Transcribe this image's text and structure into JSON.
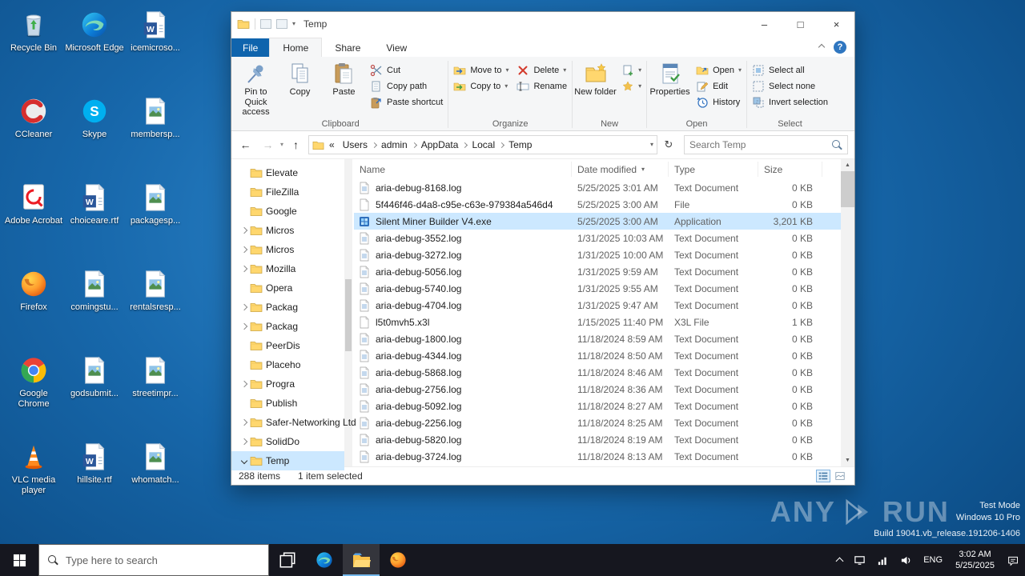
{
  "desktop": {
    "icons": [
      {
        "label": "Recycle Bin",
        "icon": "recycle-bin"
      },
      {
        "label": "CCleaner",
        "icon": "ccleaner"
      },
      {
        "label": "Adobe Acrobat",
        "icon": "acrobat"
      },
      {
        "label": "Firefox",
        "icon": "firefox"
      },
      {
        "label": "Google Chrome",
        "icon": "chrome"
      },
      {
        "label": "VLC media player",
        "icon": "vlc"
      },
      {
        "label": "Microsoft Edge",
        "icon": "edge"
      },
      {
        "label": "Skype",
        "icon": "skype"
      },
      {
        "label": "choiceare.rtf",
        "icon": "word-doc"
      },
      {
        "label": "comingstu...",
        "icon": "image-doc"
      },
      {
        "label": "godsubmit...",
        "icon": "image-doc"
      },
      {
        "label": "hillsite.rtf",
        "icon": "word-doc"
      },
      {
        "label": "icemicroso...",
        "icon": "word-doc"
      },
      {
        "label": "membersp...",
        "icon": "image-doc"
      },
      {
        "label": "packagesp...",
        "icon": "image-doc"
      },
      {
        "label": "rentalsresp...",
        "icon": "image-doc"
      },
      {
        "label": "streetimpr...",
        "icon": "image-doc"
      },
      {
        "label": "whomatch...",
        "icon": "image-doc"
      }
    ]
  },
  "window": {
    "title": "Temp",
    "tabs": [
      "File",
      "Home",
      "Share",
      "View"
    ],
    "ribbon": {
      "clipboard": {
        "label": "Clipboard",
        "pin": "Pin to Quick access",
        "copy": "Copy",
        "paste": "Paste",
        "cut": "Cut",
        "copy_path": "Copy path",
        "paste_shortcut": "Paste shortcut"
      },
      "organize": {
        "label": "Organize",
        "move_to": "Move to",
        "copy_to": "Copy to",
        "delete": "Delete",
        "rename": "Rename"
      },
      "new_group": {
        "label": "New",
        "new_folder": "New folder"
      },
      "open_group": {
        "label": "Open",
        "properties": "Properties",
        "open": "Open",
        "edit": "Edit",
        "history": "History"
      },
      "select_group": {
        "label": "Select",
        "select_all": "Select all",
        "select_none": "Select none",
        "invert": "Invert selection"
      }
    },
    "address": {
      "overflow": "«",
      "crumbs": [
        "Users",
        "admin",
        "AppData",
        "Local",
        "Temp"
      ]
    },
    "search_placeholder": "Search Temp",
    "nav": {
      "items": [
        {
          "label": "Elevate",
          "state": "none"
        },
        {
          "label": "FileZilla",
          "state": "none"
        },
        {
          "label": "Google",
          "state": "none"
        },
        {
          "label": "Micros",
          "state": "collapsed"
        },
        {
          "label": "Micros",
          "state": "collapsed"
        },
        {
          "label": "Mozilla",
          "state": "collapsed"
        },
        {
          "label": "Opera",
          "state": "none"
        },
        {
          "label": "Packag",
          "state": "collapsed"
        },
        {
          "label": "Packag",
          "state": "collapsed"
        },
        {
          "label": "PeerDis",
          "state": "none"
        },
        {
          "label": "Placeho",
          "state": "none"
        },
        {
          "label": "Progra",
          "state": "collapsed"
        },
        {
          "label": "Publish",
          "state": "none"
        },
        {
          "label": "Safer-Networking Ltd",
          "state": "collapsed"
        },
        {
          "label": "SolidDo",
          "state": "collapsed"
        },
        {
          "label": "Temp",
          "state": "expanded",
          "selected": true
        }
      ]
    },
    "list": {
      "columns": [
        "Name",
        "Date modified",
        "Type",
        "Size"
      ],
      "files": [
        {
          "name": "aria-debug-8168.log",
          "modified": "5/25/2025 3:01 AM",
          "type": "Text Document",
          "size": "0 KB",
          "icon": "text-doc"
        },
        {
          "name": "5f446f46-d4a8-c95e-c63e-979384a546d4",
          "modified": "5/25/2025 3:00 AM",
          "type": "File",
          "size": "0 KB",
          "icon": "file"
        },
        {
          "name": "Silent Miner Builder V4.exe",
          "modified": "5/25/2025 3:00 AM",
          "type": "Application",
          "size": "3,201 KB",
          "icon": "app",
          "selected": true
        },
        {
          "name": "aria-debug-3552.log",
          "modified": "1/31/2025 10:03 AM",
          "type": "Text Document",
          "size": "0 KB",
          "icon": "text-doc"
        },
        {
          "name": "aria-debug-3272.log",
          "modified": "1/31/2025 10:00 AM",
          "type": "Text Document",
          "size": "0 KB",
          "icon": "text-doc"
        },
        {
          "name": "aria-debug-5056.log",
          "modified": "1/31/2025 9:59 AM",
          "type": "Text Document",
          "size": "0 KB",
          "icon": "text-doc"
        },
        {
          "name": "aria-debug-5740.log",
          "modified": "1/31/2025 9:55 AM",
          "type": "Text Document",
          "size": "0 KB",
          "icon": "text-doc"
        },
        {
          "name": "aria-debug-4704.log",
          "modified": "1/31/2025 9:47 AM",
          "type": "Text Document",
          "size": "0 KB",
          "icon": "text-doc"
        },
        {
          "name": "l5t0mvh5.x3l",
          "modified": "1/15/2025 11:40 PM",
          "type": "X3L File",
          "size": "1 KB",
          "icon": "file"
        },
        {
          "name": "aria-debug-1800.log",
          "modified": "11/18/2024 8:59 AM",
          "type": "Text Document",
          "size": "0 KB",
          "icon": "text-doc"
        },
        {
          "name": "aria-debug-4344.log",
          "modified": "11/18/2024 8:50 AM",
          "type": "Text Document",
          "size": "0 KB",
          "icon": "text-doc"
        },
        {
          "name": "aria-debug-5868.log",
          "modified": "11/18/2024 8:46 AM",
          "type": "Text Document",
          "size": "0 KB",
          "icon": "text-doc"
        },
        {
          "name": "aria-debug-2756.log",
          "modified": "11/18/2024 8:36 AM",
          "type": "Text Document",
          "size": "0 KB",
          "icon": "text-doc"
        },
        {
          "name": "aria-debug-5092.log",
          "modified": "11/18/2024 8:27 AM",
          "type": "Text Document",
          "size": "0 KB",
          "icon": "text-doc"
        },
        {
          "name": "aria-debug-2256.log",
          "modified": "11/18/2024 8:25 AM",
          "type": "Text Document",
          "size": "0 KB",
          "icon": "text-doc"
        },
        {
          "name": "aria-debug-5820.log",
          "modified": "11/18/2024 8:19 AM",
          "type": "Text Document",
          "size": "0 KB",
          "icon": "text-doc"
        },
        {
          "name": "aria-debug-3724.log",
          "modified": "11/18/2024 8:13 AM",
          "type": "Text Document",
          "size": "0 KB",
          "icon": "text-doc"
        }
      ]
    },
    "status": {
      "items": "288 items",
      "selected": "1 item selected"
    }
  },
  "watermark": {
    "brand_left": "ANY",
    "brand_right": "RUN",
    "mode": "Test Mode",
    "os": "Windows 10 Pro",
    "build": "Build 19041.vb_release.191206-1406"
  },
  "taskbar": {
    "search_placeholder": "Type here to search",
    "lang": "ENG",
    "time": "3:02 AM",
    "date": "5/25/2025"
  }
}
